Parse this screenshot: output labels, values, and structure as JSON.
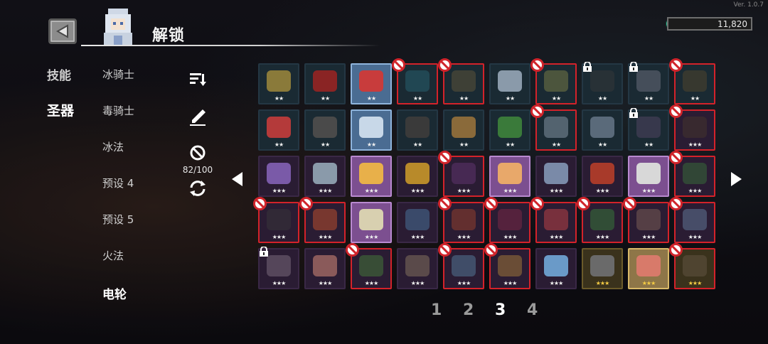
{
  "version": "Ver. 1.0.7",
  "header": {
    "title": "解锁"
  },
  "currency": {
    "amount": "11,820",
    "icon": "gem-icon",
    "color": "#2fae8a"
  },
  "categories": [
    {
      "label": "技能",
      "active": false
    },
    {
      "label": "圣器",
      "active": true
    }
  ],
  "presets": [
    {
      "label": "冰骑士",
      "active": false
    },
    {
      "label": "毒骑士",
      "active": false
    },
    {
      "label": "冰法",
      "active": false
    },
    {
      "label": "预设 4",
      "active": false
    },
    {
      "label": "预设 5",
      "active": false
    },
    {
      "label": "火法",
      "active": false
    },
    {
      "label": "电轮",
      "active": true
    }
  ],
  "tools": {
    "sort_icon": "sort-icon",
    "edit_icon": "pencil-icon",
    "ban_icon": "ban-icon",
    "ban_count": "82/100",
    "reset_icon": "refresh-icon"
  },
  "colors": {
    "ban": "#d4222a",
    "star_gold": "#f4cc44"
  },
  "relics": [
    {
      "stars": "★★",
      "state": "normal",
      "art": "#8a7a3a"
    },
    {
      "stars": "★★",
      "state": "normal",
      "art": "#8a2424"
    },
    {
      "stars": "★★",
      "state": "selected",
      "art": "#c83c3c"
    },
    {
      "stars": "★★",
      "state": "banned",
      "art": "#2a6a7a"
    },
    {
      "stars": "★★",
      "state": "banned",
      "art": "#6a5a3a"
    },
    {
      "stars": "★★",
      "state": "normal",
      "art": "#8a9aaa"
    },
    {
      "stars": "★★",
      "state": "banned",
      "art": "#8a8a4a"
    },
    {
      "stars": "★★",
      "state": "locked",
      "art": "#3a3a3a"
    },
    {
      "stars": "★★",
      "state": "locked",
      "art": "#7a7a8a"
    },
    {
      "stars": "★★",
      "state": "banned",
      "art": "#5a4a2a"
    },
    {
      "stars": "★★",
      "state": "normal",
      "art": "#b43a3a"
    },
    {
      "stars": "★★",
      "state": "normal",
      "art": "#4a4a4a"
    },
    {
      "stars": "★★",
      "state": "selected",
      "art": "#c8d8e8"
    },
    {
      "stars": "★★",
      "state": "normal",
      "art": "#3a3a3a"
    },
    {
      "stars": "★★",
      "state": "normal",
      "art": "#8a6a3a"
    },
    {
      "stars": "★★",
      "state": "normal",
      "art": "#3a7a3a"
    },
    {
      "stars": "★★",
      "state": "banned",
      "art": "#9aa8b8"
    },
    {
      "stars": "★★",
      "state": "normal",
      "art": "#5a6a7a"
    },
    {
      "stars": "★★",
      "state": "locked",
      "art": "#5a4a6a"
    },
    {
      "stars": "★★★",
      "state": "banned",
      "art": "#4a3a2a"
    },
    {
      "stars": "★★★",
      "state": "normal",
      "art": "#7a5aa8"
    },
    {
      "stars": "★★★",
      "state": "normal",
      "art": "#8a9aaa"
    },
    {
      "stars": "★★★",
      "state": "selected-purple",
      "art": "#e8b04a"
    },
    {
      "stars": "★★★",
      "state": "normal",
      "art": "#b88a2a"
    },
    {
      "stars": "★★★",
      "state": "banned",
      "art": "#6a3a7a"
    },
    {
      "stars": "★★★",
      "state": "selected-purple",
      "art": "#e8a86a"
    },
    {
      "stars": "★★★",
      "state": "normal",
      "art": "#7a8aa8"
    },
    {
      "stars": "★★★",
      "state": "normal",
      "art": "#a83a2a"
    },
    {
      "stars": "★★★",
      "state": "selected-purple",
      "art": "#d8d8d8"
    },
    {
      "stars": "★★★",
      "state": "banned",
      "art": "#3a7a3a"
    },
    {
      "stars": "★★★",
      "state": "banned",
      "art": "#3a3a3a"
    },
    {
      "stars": "★★★",
      "state": "banned",
      "art": "#d8582a"
    },
    {
      "stars": "★★★",
      "state": "selected-purple",
      "art": "#d8d0b0"
    },
    {
      "stars": "★★★",
      "state": "normal",
      "art": "#3a4a6a"
    },
    {
      "stars": "★★★",
      "state": "banned",
      "art": "#a8482a"
    },
    {
      "stars": "★★★",
      "state": "banned",
      "art": "#8a2a4a"
    },
    {
      "stars": "★★★",
      "state": "banned",
      "art": "#d84a4a"
    },
    {
      "stars": "★★★",
      "state": "banned",
      "art": "#3a8a3a"
    },
    {
      "stars": "★★★",
      "state": "banned",
      "art": "#8a6a5a"
    },
    {
      "stars": "★★★",
      "state": "banned",
      "art": "#6a8aa8"
    },
    {
      "stars": "★★★",
      "state": "locked",
      "art": "#8a7a8a"
    },
    {
      "stars": "★★★",
      "state": "normal",
      "art": "#8a5a5a"
    },
    {
      "stars": "★★★",
      "state": "banned",
      "art": "#4a8a3a"
    },
    {
      "stars": "★★★",
      "state": "normal",
      "art": "#5a4a4a"
    },
    {
      "stars": "★★★",
      "state": "banned",
      "art": "#5a8aa8"
    },
    {
      "stars": "★★★",
      "state": "banned",
      "art": "#b88a3a"
    },
    {
      "stars": "★★★",
      "state": "normal",
      "art": "#6a9ac8"
    },
    {
      "stars": "★★★",
      "state": "gold",
      "art": "#6a6a6a"
    },
    {
      "stars": "★★★",
      "state": "gold-selected",
      "art": "#d87a6a"
    },
    {
      "stars": "★★★",
      "state": "gold-banned",
      "art": "#6a5a4a"
    }
  ],
  "pagination": {
    "pages": [
      "1",
      "2",
      "3",
      "4"
    ],
    "active_index": 2
  }
}
